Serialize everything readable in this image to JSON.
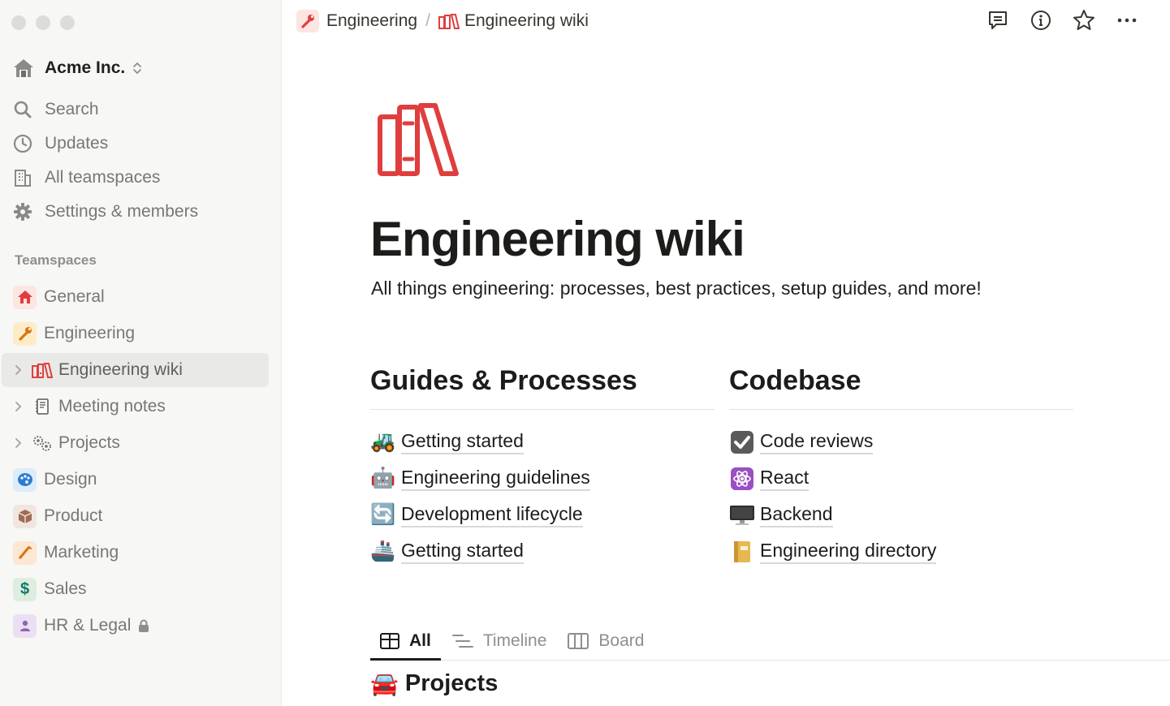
{
  "workspace": {
    "name": "Acme Inc."
  },
  "nav": [
    {
      "label": "Search",
      "icon": "search-icon"
    },
    {
      "label": "Updates",
      "icon": "clock-icon"
    },
    {
      "label": "All teamspaces",
      "icon": "building-icon"
    },
    {
      "label": "Settings & members",
      "icon": "gear-icon"
    }
  ],
  "teamspaces": {
    "label": "Teamspaces",
    "items": [
      {
        "label": "General",
        "icon": "house-icon",
        "emoji": "🏠",
        "bg": "#fde5e2"
      },
      {
        "label": "Engineering",
        "icon": "wrench-icon",
        "emoji": "🔧",
        "bg": "#fdecc8"
      },
      {
        "label": "Engineering wiki",
        "icon": "books-icon",
        "active": true
      },
      {
        "label": "Meeting notes",
        "icon": "notebook-icon"
      },
      {
        "label": "Projects",
        "icon": "gears-icon"
      },
      {
        "label": "Design",
        "icon": "palette-icon",
        "emoji": "🎨",
        "bg": "#dcecfa"
      },
      {
        "label": "Product",
        "icon": "package-icon",
        "emoji": "📦",
        "bg": "#f1e6df"
      },
      {
        "label": "Marketing",
        "icon": "pencil-icon",
        "emoji": "✏️",
        "bg": "#fde6d3"
      },
      {
        "label": "Sales",
        "icon": "dollar-icon",
        "emoji": "$",
        "bg": "#ddedde"
      },
      {
        "label": "HR & Legal",
        "icon": "person-icon",
        "emoji": "👤",
        "bg": "#ebe0f3"
      }
    ]
  },
  "breadcrumb": {
    "parent": "Engineering",
    "separator": "/",
    "current": "Engineering wiki"
  },
  "page": {
    "title": "Engineering wiki",
    "description": "All things engineering: processes, best practices, setup guides, and more!"
  },
  "columns": [
    {
      "heading": "Guides & Processes",
      "links": [
        {
          "emoji": "🚜",
          "label": "Getting started"
        },
        {
          "emoji": "🤖",
          "label": "Engineering guidelines"
        },
        {
          "emoji": "🔄",
          "label": "Development lifecycle"
        },
        {
          "emoji": "🚢",
          "label": "Getting started"
        }
      ]
    },
    {
      "heading": "Codebase",
      "links": [
        {
          "emoji": "✔",
          "label": "Code reviews"
        },
        {
          "emoji": "⚛",
          "label": "React"
        },
        {
          "emoji": "🖥",
          "label": "Backend"
        },
        {
          "emoji": "📔",
          "label": "Engineering directory"
        }
      ]
    }
  ],
  "views": [
    {
      "label": "All",
      "icon": "table-icon",
      "active": true
    },
    {
      "label": "Timeline",
      "icon": "timeline-icon"
    },
    {
      "label": "Board",
      "icon": "board-icon"
    }
  ],
  "database": {
    "emoji": "🚘",
    "title": "Projects"
  },
  "colors": {
    "accent_red": "#e03e3e",
    "sidebar_bg": "#f7f7f5",
    "text": "#37352f"
  }
}
